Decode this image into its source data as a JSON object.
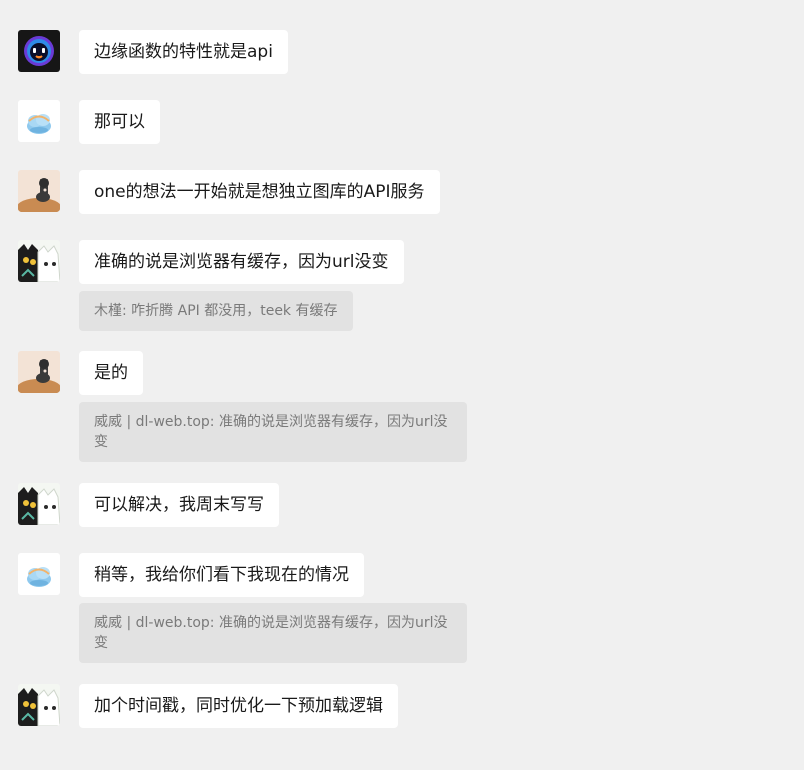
{
  "messages": [
    {
      "avatar": "robot-avatar",
      "text": "边缘函数的特性就是api"
    },
    {
      "avatar": "cloud-avatar",
      "text": "那可以"
    },
    {
      "avatar": "cat-desert-avatar",
      "text": "one的想法一开始就是想独立图库的API服务"
    },
    {
      "avatar": "cartoon-cats-avatar",
      "text": "准确的说是浏览器有缓存，因为url没变",
      "quote": "木槿: 咋折腾 API 都没用，teek 有缓存"
    },
    {
      "avatar": "cat-desert-avatar",
      "text": "是的",
      "quote": "威威 | dl-web.top: 准确的说是浏览器有缓存，因为url没变"
    },
    {
      "avatar": "cartoon-cats-avatar",
      "text": "可以解决，我周末写写"
    },
    {
      "avatar": "cloud-avatar",
      "text": "稍等，我给你们看下我现在的情况",
      "quote": "威威 | dl-web.top: 准确的说是浏览器有缓存，因为url没变"
    },
    {
      "avatar": "cartoon-cats-avatar",
      "text": "加个时间戳，同时优化一下预加载逻辑"
    }
  ],
  "colors": {
    "background": "#f0f0f0",
    "bubble": "#ffffff",
    "quote": "#e2e2e2",
    "text": "#191919",
    "quote_text": "#7a7a7a"
  }
}
